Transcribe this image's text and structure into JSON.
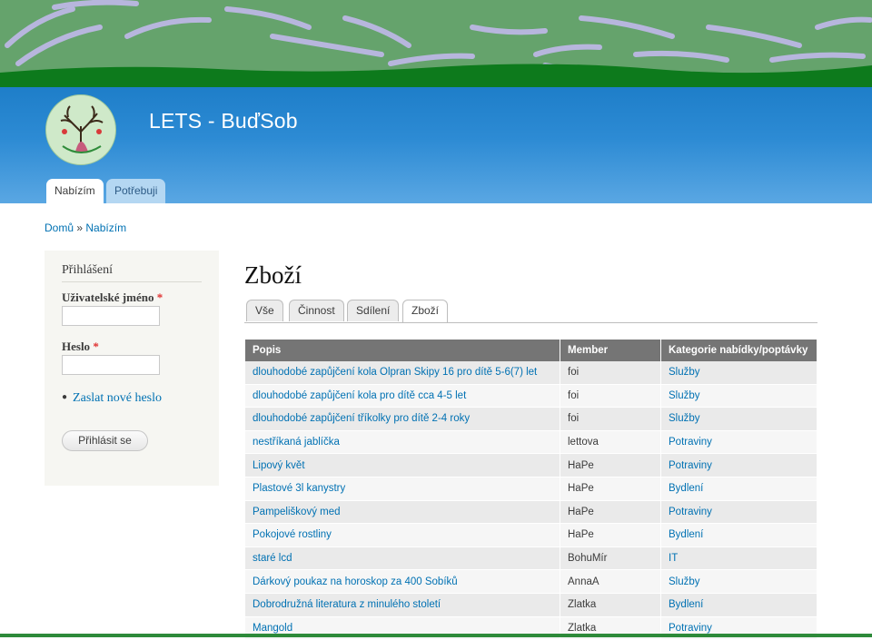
{
  "site": {
    "name": "LETS - BuďSob"
  },
  "main_tabs": [
    {
      "label": "Nabízím",
      "active": true
    },
    {
      "label": "Potřebuji",
      "active": false
    }
  ],
  "breadcrumb": {
    "home": "Domů",
    "separator": "»",
    "current": "Nabízím"
  },
  "login": {
    "title": "Přihlášení",
    "username_label": "Uživatelské jméno",
    "password_label": "Heslo",
    "required_mark": "*",
    "username_value": "",
    "password_value": "",
    "reset_link": "Zaslat nové heslo",
    "submit": "Přihlásit se"
  },
  "page": {
    "title": "Zboží"
  },
  "sub_tabs": [
    {
      "label": "Vše",
      "active": false
    },
    {
      "label": "Činnost",
      "active": false
    },
    {
      "label": "Sdílení",
      "active": false
    },
    {
      "label": "Zboží",
      "active": true
    }
  ],
  "table": {
    "headers": [
      "Popis",
      "Member",
      "Kategorie nabídky/poptávky"
    ],
    "rows": [
      [
        "dlouhodobé zapůjčení kola Olpran Skipy 16 pro dítě 5-6(7) let",
        "foi",
        "Služby"
      ],
      [
        "dlouhodobé zapůjčení kola pro dítě cca 4-5 let",
        "foi",
        "Služby"
      ],
      [
        "dlouhodobé zapůjčení tříkolky pro dítě 2-4 roky",
        "foi",
        "Služby"
      ],
      [
        "nestříkaná jablíčka",
        "lettova",
        "Potraviny"
      ],
      [
        "Lipový květ",
        "HaPe",
        "Potraviny"
      ],
      [
        "Plastové 3l kanystry",
        "HaPe",
        "Bydlení"
      ],
      [
        "Pampeliškový med",
        "HaPe",
        "Potraviny"
      ],
      [
        "Pokojové rostliny",
        "HaPe",
        "Bydlení"
      ],
      [
        "staré lcd",
        "BohuMír",
        "IT"
      ],
      [
        "Dárkový poukaz na horoskop za 400 Sobíků",
        "AnnaA",
        "Služby"
      ],
      [
        "Dobrodružná literatura z minulého století",
        "Zlatka",
        "Bydlení"
      ],
      [
        "Mangold",
        "Zlatka",
        "Potraviny"
      ]
    ]
  },
  "colors": {
    "header_blue": "#2d8bd4",
    "banner_green": "#65a36c",
    "link": "#0071b3",
    "table_header": "#757575"
  }
}
